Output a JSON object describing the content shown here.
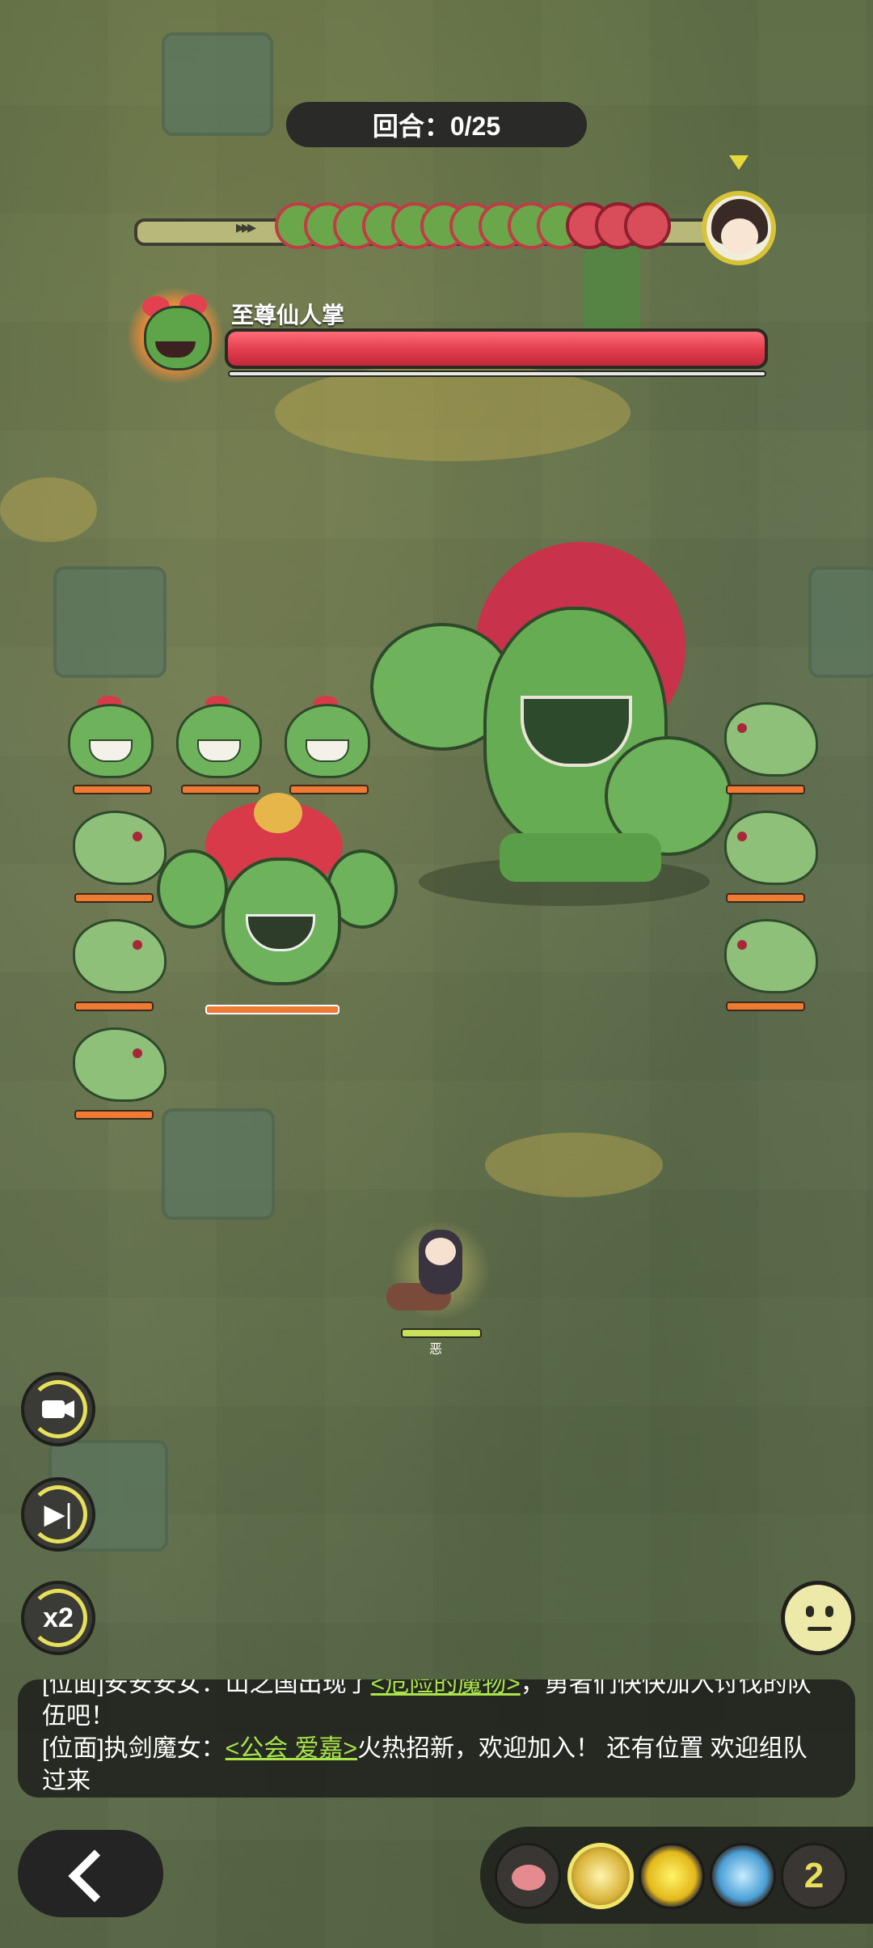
{
  "hud": {
    "round_label": "回合：0/25",
    "queue_arrows": "▸▸▸",
    "queue_count": 13
  },
  "boss": {
    "name": "至尊仙人掌",
    "hp_fraction": 1.0
  },
  "player": {
    "tag": "恶"
  },
  "controls": {
    "camera_icon": "camera-icon",
    "skip_icon": "skip-icon",
    "skip_glyph": "▶|",
    "speed_label": "x2"
  },
  "emote": {
    "icon": "neutral-face-icon"
  },
  "chat": {
    "line_partial": "[位面]安安安女：山之国出现了<危险的魔物>，勇者们快快加入讨伐的队伍吧！",
    "line_partial_prefix": "[位面]安安安女：山之国出现了",
    "line_partial_link": "<危险的魔物>",
    "line_partial_suffix": "，勇者们快快加入讨伐的队伍吧！",
    "line_main_prefix": "[位面]执剑魔女：",
    "line_main_link": "<公会 爱嘉>",
    "line_main_suffix": "火热招新，欢迎加入！ 还有位置 欢迎组队过来"
  },
  "nav": {
    "back_icon": "chevron-left-icon"
  },
  "buffs": {
    "icons": [
      "pig-icon",
      "rune-icon",
      "sun-icon",
      "ice-crystal-icon"
    ],
    "more_count": "2"
  },
  "colors": {
    "accent": "#e6e05a",
    "hp_red": "#e23c4c",
    "enemy_bar": "#ee7a34",
    "chat_link": "#a9e44a"
  }
}
